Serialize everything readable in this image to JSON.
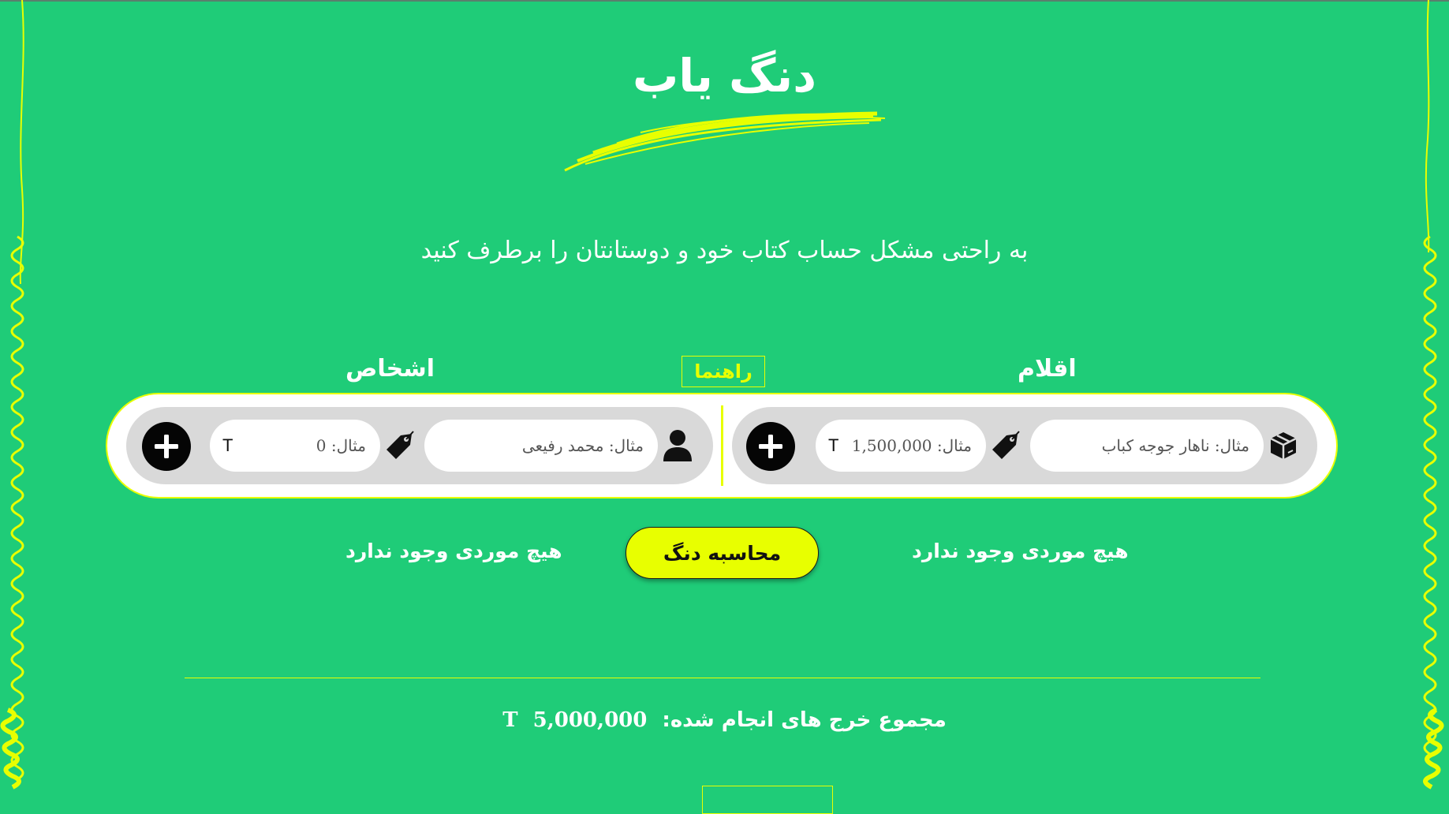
{
  "app": {
    "title": "دنگ یاب",
    "subtitle": "به راحتی مشکل حساب کتاب خود و دوستانتان را برطرف کنید"
  },
  "sections": {
    "items_label": "اقلام",
    "people_label": "اشخاص",
    "guide_label": "راهنما"
  },
  "items_form": {
    "name_placeholder": "مثال: ناهار جوجه کباب",
    "price_placeholder": "مثال: 1,500,000",
    "currency": "T",
    "icons": {
      "item": "box-icon",
      "price": "price-tag-icon",
      "add": "plus-icon"
    }
  },
  "people_form": {
    "name_placeholder": "مثال: محمد رفیعی",
    "amount_placeholder": "مثال: 0",
    "currency": "T",
    "icons": {
      "person": "user-icon",
      "amount": "price-tag-icon",
      "add": "plus-icon"
    }
  },
  "empty_state": {
    "items": "هیچ موردی وجود ندارد",
    "people": "هیچ موردی وجود ندارد"
  },
  "actions": {
    "calculate_label": "محاسبه دنگ"
  },
  "summary": {
    "total_label": "مجموع خرج های انجام شده:",
    "total_value": "5,000,000",
    "currency": "T"
  },
  "colors": {
    "background": "#1fcc78",
    "accent": "#e8ff00",
    "panel": "#d9d9d9",
    "button_dark": "#050505"
  }
}
